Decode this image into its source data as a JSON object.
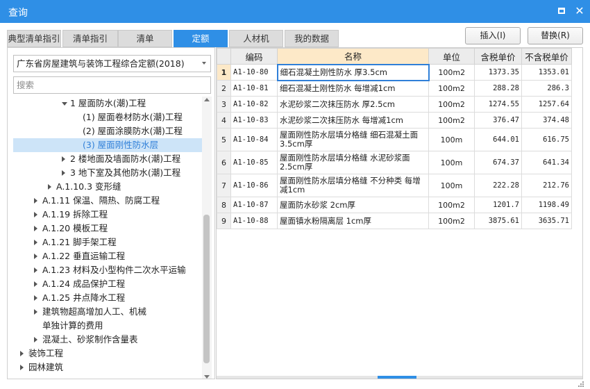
{
  "window": {
    "title": "查询"
  },
  "tabs": [
    {
      "label": "典型清单指引",
      "active": false
    },
    {
      "label": "清单指引",
      "active": false
    },
    {
      "label": "清单",
      "active": false
    },
    {
      "label": "定额",
      "active": true
    },
    {
      "label": "人材机",
      "active": false
    },
    {
      "label": "我的数据",
      "active": false
    }
  ],
  "buttons": {
    "insert": "插入(I)",
    "replace": "替换(R)"
  },
  "left_panel": {
    "library_select": "广东省房屋建筑与装饰工程综合定额(2018)",
    "search_placeholder": "搜索",
    "tree": [
      {
        "label": "1 屋面防水(潮)工程",
        "toggle": "expanded",
        "depth": 4
      },
      {
        "label": "(1) 屋面卷材防水(潮)工程",
        "toggle": "none",
        "depth": 5
      },
      {
        "label": "(2) 屋面涂膜防水(潮)工程",
        "toggle": "none",
        "depth": 5
      },
      {
        "label": "(3) 屋面刚性防水层",
        "toggle": "none",
        "depth": 5,
        "selected": true
      },
      {
        "label": "2 楼地面及墙面防水(潮)工程",
        "toggle": "collapsed",
        "depth": 4
      },
      {
        "label": "3 地下室及其他防水(潮)工程",
        "toggle": "collapsed",
        "depth": 4
      },
      {
        "label": "A.1.10.3 变形缝",
        "toggle": "collapsed",
        "depth": 3
      },
      {
        "label": "A.1.11 保温、隔热、防腐工程",
        "toggle": "collapsed",
        "depth": 2
      },
      {
        "label": "A.1.19 拆除工程",
        "toggle": "collapsed",
        "depth": 2
      },
      {
        "label": "A.1.20 模板工程",
        "toggle": "collapsed",
        "depth": 2
      },
      {
        "label": "A.1.21 脚手架工程",
        "toggle": "collapsed",
        "depth": 2
      },
      {
        "label": "A.1.22 垂直运输工程",
        "toggle": "collapsed",
        "depth": 2
      },
      {
        "label": "A.1.23 材料及小型构件二次水平运输",
        "toggle": "collapsed",
        "depth": 2
      },
      {
        "label": "A.1.24 成品保护工程",
        "toggle": "collapsed",
        "depth": 2
      },
      {
        "label": "A.1.25 井点降水工程",
        "toggle": "collapsed",
        "depth": 2
      },
      {
        "label": "建筑物超高增加人工、机械",
        "toggle": "collapsed",
        "depth": 2
      },
      {
        "label": "单独计算的费用",
        "toggle": "none",
        "depth": 2
      },
      {
        "label": "混凝土、砂浆制作含量表",
        "toggle": "collapsed",
        "depth": 2
      },
      {
        "label": "装饰工程",
        "toggle": "collapsed",
        "depth": 1
      },
      {
        "label": "园林建筑",
        "toggle": "collapsed",
        "depth": 1
      }
    ]
  },
  "table": {
    "columns": [
      "编码",
      "名称",
      "单位",
      "含税单价",
      "不含税单价"
    ],
    "rows": [
      {
        "idx": "1",
        "code": "A1-10-80",
        "name": "细石混凝土刚性防水 厚3.5cm",
        "unit": "100m2",
        "tax_price": "1373.35",
        "notax_price": "1353.01",
        "selected": true
      },
      {
        "idx": "2",
        "code": "A1-10-81",
        "name": "细石混凝土刚性防水 每增减1cm",
        "unit": "100m2",
        "tax_price": "288.28",
        "notax_price": "286.3"
      },
      {
        "idx": "3",
        "code": "A1-10-82",
        "name": "水泥砂浆二次抹压防水 厚2.5cm",
        "unit": "100m2",
        "tax_price": "1274.55",
        "notax_price": "1257.64"
      },
      {
        "idx": "4",
        "code": "A1-10-83",
        "name": "水泥砂浆二次抹压防水 每增减1cm",
        "unit": "100m2",
        "tax_price": "376.47",
        "notax_price": "374.48"
      },
      {
        "idx": "5",
        "code": "A1-10-84",
        "name": "屋面刚性防水层填分格缝 细石混凝土面3.5cm厚",
        "unit": "100m",
        "tax_price": "644.01",
        "notax_price": "616.75"
      },
      {
        "idx": "6",
        "code": "A1-10-85",
        "name": "屋面刚性防水层填分格缝 水泥砂浆面2.5cm厚",
        "unit": "100m",
        "tax_price": "674.37",
        "notax_price": "641.34"
      },
      {
        "idx": "7",
        "code": "A1-10-86",
        "name": "屋面刚性防水层填分格缝 不分种类 每增减1cm",
        "unit": "100m",
        "tax_price": "222.28",
        "notax_price": "212.76"
      },
      {
        "idx": "8",
        "code": "A1-10-87",
        "name": "屋面防水砂浆 2cm厚",
        "unit": "100m2",
        "tax_price": "1201.7",
        "notax_price": "1198.49"
      },
      {
        "idx": "9",
        "code": "A1-10-88",
        "name": "屋面镇水粉隔离层 1cm厚",
        "unit": "100m2",
        "tax_price": "3875.61",
        "notax_price": "3635.71"
      }
    ]
  },
  "colors": {
    "accent": "#2f8fe6",
    "selected_row_bg": "#cde4f8",
    "name_header_bg": "#fde9c8"
  }
}
